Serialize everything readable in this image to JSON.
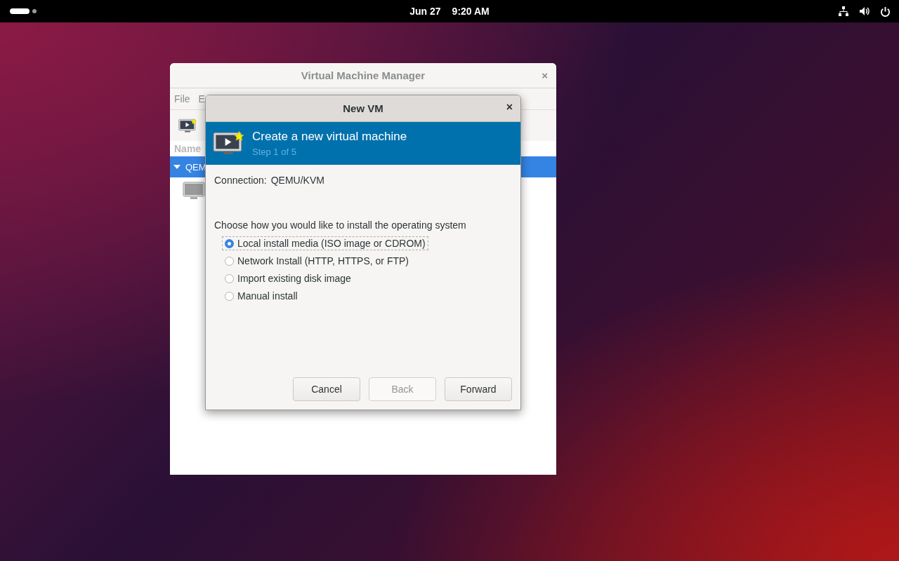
{
  "top_bar": {
    "date": "Jun 27",
    "time": "9:20 AM"
  },
  "main_window": {
    "title": "Virtual Machine Manager",
    "close": "×",
    "menu": [
      "File",
      "E"
    ],
    "column_header": "Name",
    "connection_row": {
      "label": "QEM",
      "expanded": true,
      "selected": true
    }
  },
  "dialog": {
    "title": "New VM",
    "close": "×",
    "header": {
      "title": "Create a new virtual machine",
      "subtitle": "Step 1 of 5"
    },
    "connection_label": "Connection:",
    "connection_value": "QEMU/KVM",
    "prompt": "Choose how you would like to install the operating system",
    "options": [
      {
        "label": "Local install media (ISO image or CDROM)",
        "selected": true
      },
      {
        "label": "Network Install (HTTP, HTTPS, or FTP)",
        "selected": false
      },
      {
        "label": "Import existing disk image",
        "selected": false
      },
      {
        "label": "Manual install",
        "selected": false
      }
    ],
    "buttons": [
      {
        "label": "Cancel",
        "disabled": false
      },
      {
        "label": "Back",
        "disabled": true
      },
      {
        "label": "Forward",
        "disabled": false
      }
    ]
  }
}
